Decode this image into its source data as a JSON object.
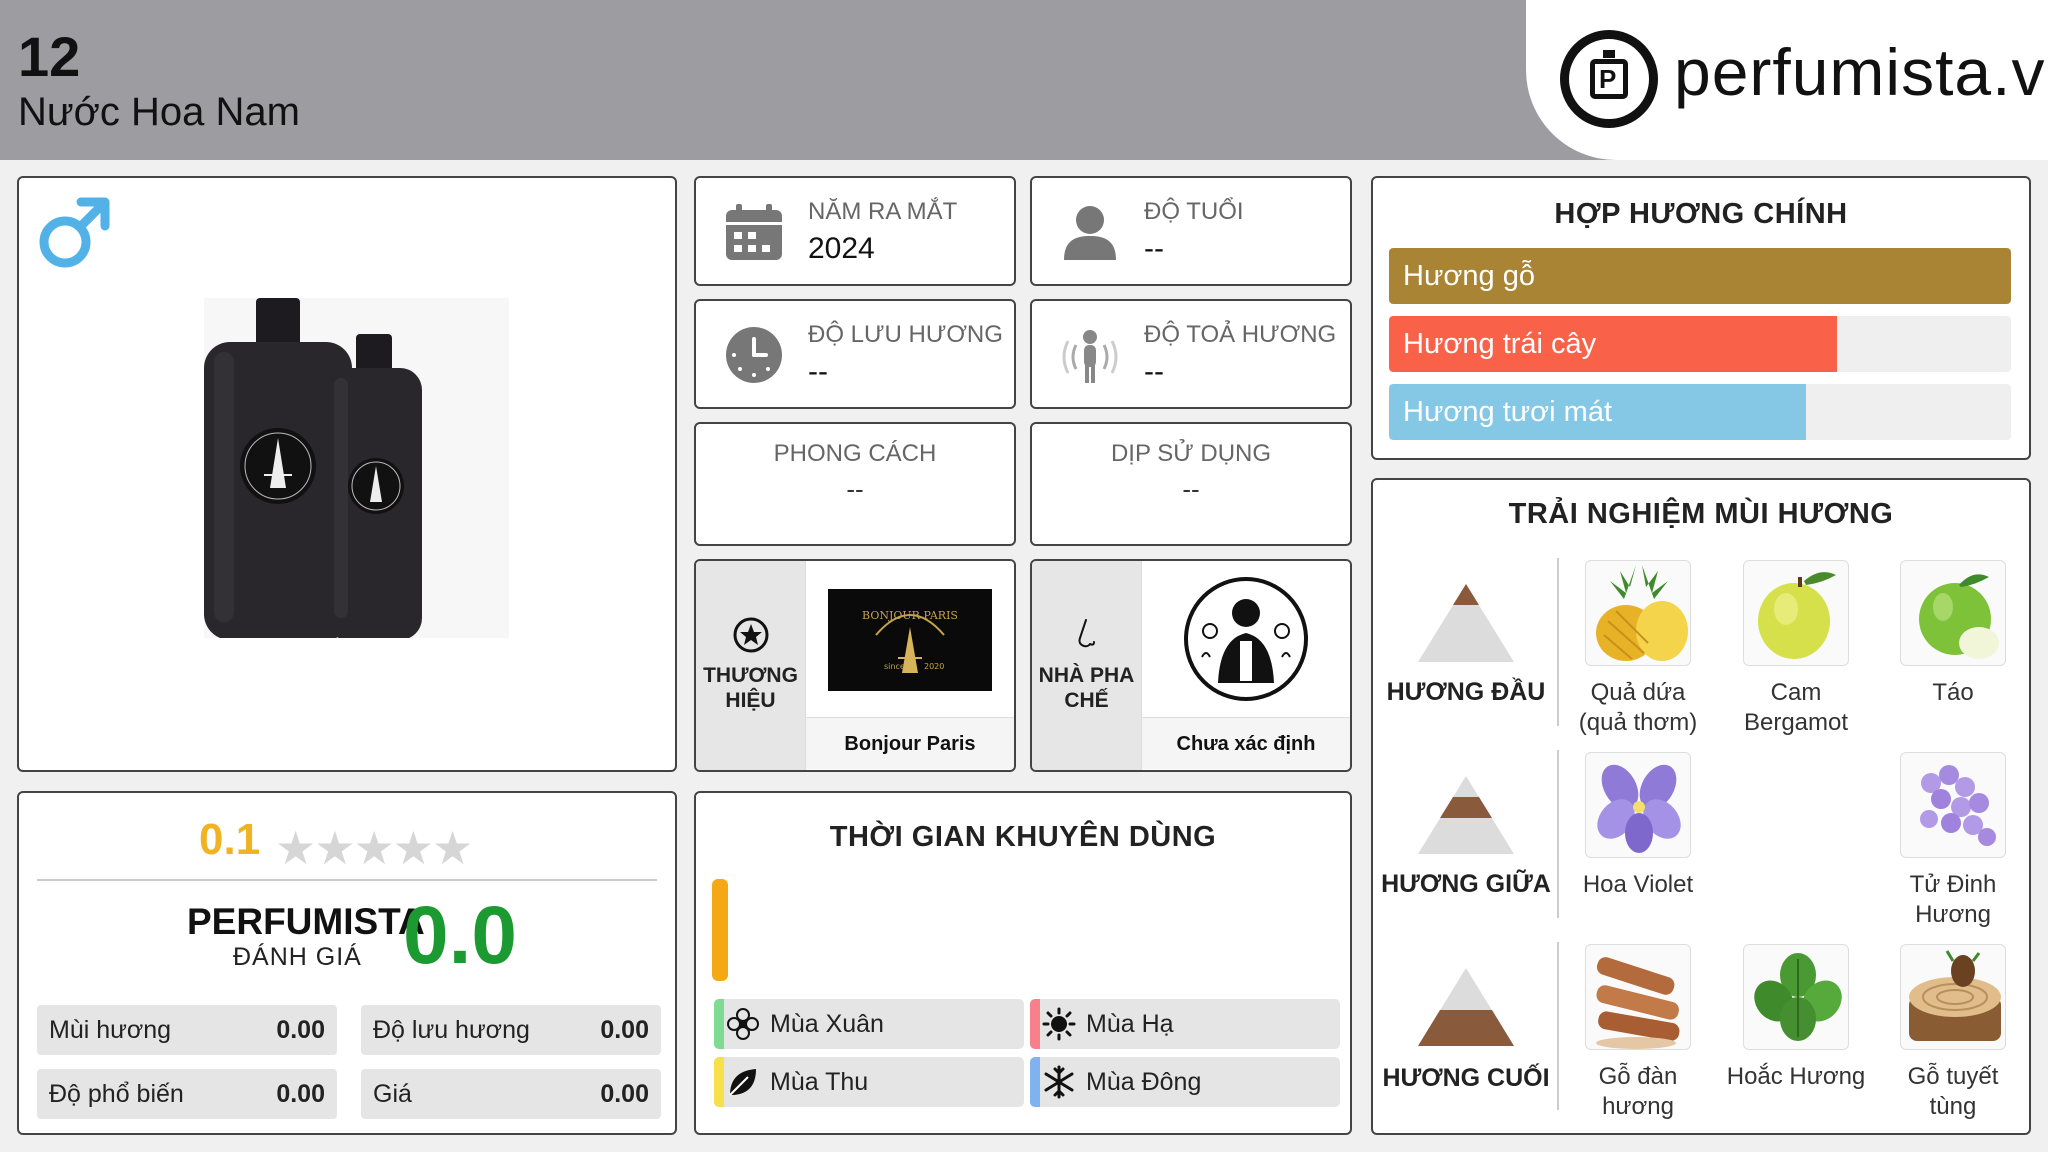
{
  "header": {
    "number": "12",
    "category": "Nước Hoa Nam",
    "logo_text": "perfumista.vn"
  },
  "product": {
    "gender_icon": "male-symbol-icon",
    "image": "two-black-perfume-bottles"
  },
  "info": {
    "release_label": "NĂM RA MẮT",
    "release_value": "2024",
    "age_label": "ĐỘ TUỔI",
    "age_value": "--",
    "longevity_label": "ĐỘ LƯU HƯƠNG",
    "longevity_value": "--",
    "sillage_label": "ĐỘ TOẢ HƯƠNG",
    "sillage_value": "--",
    "style_label": "PHONG CÁCH",
    "style_value": "--",
    "occasion_label": "DỊP SỬ DỤNG",
    "occasion_value": "--"
  },
  "brand": {
    "label": "THƯƠNG HIỆU",
    "name": "Bonjour Paris"
  },
  "perfumer": {
    "label": "NHÀ PHA CHẾ",
    "name": "Chưa xác định"
  },
  "accords": {
    "title": "HỢP HƯƠNG CHÍNH",
    "items": [
      {
        "label": "Hương gỗ",
        "percent": 100,
        "color": "#a88434"
      },
      {
        "label": "Hương trái cây",
        "percent": 72,
        "color": "#f96249"
      },
      {
        "label": "Hương tươi mát",
        "percent": 67,
        "color": "#85c8e6"
      }
    ]
  },
  "scent": {
    "title": "TRẢI NGHIỆM MÙI HƯƠNG",
    "top_label": "HƯƠNG ĐẦU",
    "middle_label": "HƯƠNG GIỮA",
    "base_label": "HƯƠNG CUỐI",
    "top_notes": [
      "Quả dứa\n(quả thơm)",
      "Cam\nBergamot",
      "Táo"
    ],
    "middle_notes": [
      "Hoa Violet",
      "Tử Đinh\nHương"
    ],
    "base_notes": [
      "Gỗ đàn\nhương",
      "Hoắc Hương",
      "Gỗ tuyết\ntùng"
    ]
  },
  "rating": {
    "user_score": "0.1",
    "stars": 0,
    "pf_name": "PERFUMISTA",
    "pf_sub": "ĐÁNH GIÁ",
    "pf_score": "0.0",
    "metrics": [
      {
        "label": "Mùi hương",
        "value": "0.00"
      },
      {
        "label": "Độ lưu hương",
        "value": "0.00"
      },
      {
        "label": "Độ phổ biến",
        "value": "0.00"
      },
      {
        "label": "Giá",
        "value": "0.00"
      }
    ]
  },
  "season": {
    "title": "THỜI GIAN KHUYÊN DÙNG",
    "items": [
      {
        "label": "Mùa Xuân",
        "color": "#7ddc92",
        "icon": "flower-icon"
      },
      {
        "label": "Mùa Hạ",
        "color": "#f7808a",
        "icon": "sun-icon"
      },
      {
        "label": "Mùa Thu",
        "color": "#f7e04a",
        "icon": "leaf-icon"
      },
      {
        "label": "Mùa Đông",
        "color": "#7fb2ee",
        "icon": "snowflake-icon"
      }
    ],
    "colors": {
      "daytime_bar": "#f5a815"
    }
  }
}
